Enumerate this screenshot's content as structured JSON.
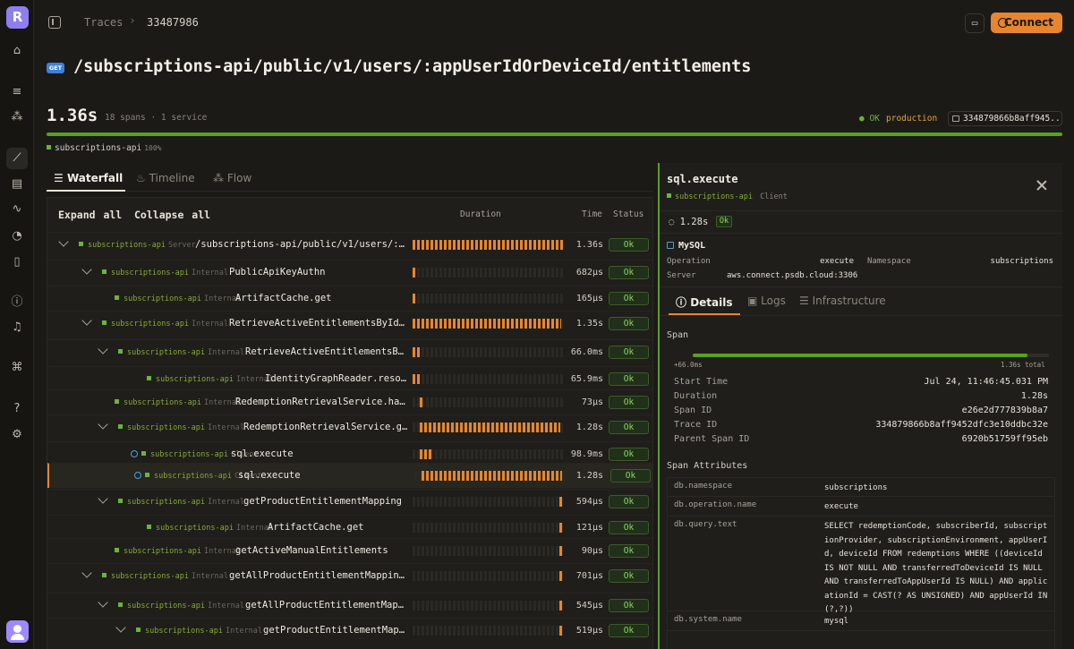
{
  "breadcrumb": {
    "parent": "Traces",
    "current": "33487986"
  },
  "header": {
    "connect_label": "Connect"
  },
  "trace": {
    "method": "GET",
    "path": "/subscriptions-api/public/v1/users/:appUserIdOrDeviceId/entitlements",
    "duration": "1.36s",
    "summary": "18 spans · 1 service",
    "status": "OK",
    "environment": "production",
    "trace_id_short": "334879866b8aff945...",
    "service_bar": {
      "name": "subscriptions-api",
      "percent": "100%"
    }
  },
  "tabs": [
    {
      "label": "Waterfall",
      "icon": "list-icon"
    },
    {
      "label": "Timeline",
      "icon": "flame-icon"
    },
    {
      "label": "Flow",
      "icon": "flow-icon"
    }
  ],
  "table": {
    "expand_label": "Expand all",
    "collapse_label": "Collapse all",
    "col_duration": "Duration",
    "col_time": "Time",
    "col_status": "Status",
    "rows": [
      {
        "service": "subscriptions-api",
        "kind": "Server",
        "name": "/subscriptions-api/public/v1/users/:app…",
        "time": "1.36s",
        "status": "Ok",
        "bar_start": 0.0,
        "bar_width": 1.0,
        "expanded": true
      },
      {
        "service": "subscriptions-api",
        "kind": "Internal",
        "name": "PublicApiKeyAuthn",
        "time": "682µs",
        "status": "Ok",
        "bar_start": 0.0,
        "bar_width": 0.02,
        "expanded": true
      },
      {
        "service": "subscriptions-api",
        "kind": "Internal",
        "name": "ArtifactCache.get",
        "time": "165µs",
        "status": "Ok",
        "bar_start": 0.0,
        "bar_width": 0.02
      },
      {
        "service": "subscriptions-api",
        "kind": "Internal",
        "name": "RetrieveActiveEntitlementsByIdent…",
        "time": "1.35s",
        "status": "Ok",
        "bar_start": 0.0,
        "bar_width": 0.99,
        "expanded": true
      },
      {
        "service": "subscriptions-api",
        "kind": "Internal",
        "name": "RetrieveActiveEntitlementsByI…",
        "time": "66.0ms",
        "status": "Ok",
        "bar_start": 0.0,
        "bar_width": 0.05,
        "expanded": true
      },
      {
        "service": "subscriptions-api",
        "kind": "Internal",
        "name": "IdentityGraphReader.resolv…",
        "time": "65.9ms",
        "status": "Ok",
        "bar_start": 0.0,
        "bar_width": 0.05
      },
      {
        "service": "subscriptions-api",
        "kind": "Internal",
        "name": "RedemptionRetrievalService.hasA…",
        "time": "73µs",
        "status": "Ok",
        "bar_start": 0.045,
        "bar_width": 0.02
      },
      {
        "service": "subscriptions-api",
        "kind": "Internal",
        "name": "RedemptionRetrievalService.get…",
        "time": "1.28s",
        "status": "Ok",
        "bar_start": 0.045,
        "bar_width": 0.94,
        "expanded": true
      },
      {
        "service": "subscriptions-api",
        "kind": "Client",
        "name": "sql.execute",
        "time": "98.9ms",
        "status": "Ok",
        "bar_start": 0.045,
        "bar_width": 0.08,
        "db": true
      },
      {
        "service": "subscriptions-api",
        "kind": "Client",
        "name": "sql.execute",
        "time": "1.28s",
        "status": "Ok",
        "bar_start": 0.045,
        "bar_width": 0.94,
        "db": true,
        "selected": true
      },
      {
        "service": "subscriptions-api",
        "kind": "Internal",
        "name": "getProductEntitlementMapping",
        "time": "594µs",
        "status": "Ok",
        "bar_start": 0.975,
        "bar_width": 0.02,
        "expanded": true
      },
      {
        "service": "subscriptions-api",
        "kind": "Internal",
        "name": "ArtifactCache.get",
        "time": "121µs",
        "status": "Ok",
        "bar_start": 0.975,
        "bar_width": 0.02
      },
      {
        "service": "subscriptions-api",
        "kind": "Internal",
        "name": "getActiveManualEntitlements",
        "time": "90µs",
        "status": "Ok",
        "bar_start": 0.975,
        "bar_width": 0.02
      },
      {
        "service": "subscriptions-api",
        "kind": "Internal",
        "name": "getAllProductEntitlementMappingBy…",
        "time": "701µs",
        "status": "Ok",
        "bar_start": 0.975,
        "bar_width": 0.02,
        "expanded": true
      },
      {
        "service": "subscriptions-api",
        "kind": "Internal",
        "name": "getAllProductEntitlementMappi…",
        "time": "545µs",
        "status": "Ok",
        "bar_start": 0.975,
        "bar_width": 0.02,
        "expanded": true
      },
      {
        "service": "subscriptions-api",
        "kind": "Internal",
        "name": "getProductEntitlementMappi…",
        "time": "519µs",
        "status": "Ok",
        "bar_start": 0.975,
        "bar_width": 0.02,
        "expanded": true
      }
    ]
  },
  "detail": {
    "title": "sql.execute",
    "service": "subscriptions-api",
    "kind": "Client",
    "duration": "1.28s",
    "status": "Ok",
    "db_system": "MySQL",
    "operation_label": "Operation",
    "operation_value": "execute",
    "namespace_label": "Namespace",
    "namespace_value": "subscriptions",
    "server_label": "Server",
    "server_value": "aws.connect.psdb.cloud:3306",
    "tabs": [
      {
        "label": "Details",
        "icon": "info-icon"
      },
      {
        "label": "Logs",
        "icon": "terminal-icon"
      },
      {
        "label": "Infrastructure",
        "icon": "server-icon"
      }
    ],
    "span_section": "Span",
    "span_offset": "+66.0ms",
    "span_total": "1.36s total",
    "span_fill": 0.94,
    "fields": [
      {
        "label": "Start Time",
        "value": "Jul 24, 11:46:45.031 PM"
      },
      {
        "label": "Duration",
        "value": "1.28s"
      },
      {
        "label": "Span ID",
        "value": "e26e2d777839b8a7"
      },
      {
        "label": "Trace ID",
        "value": "334879866b8aff9452dfc3e10ddbc32e"
      },
      {
        "label": "Parent Span ID",
        "value": "6920b51759ff95eb"
      }
    ],
    "attributes_section": "Span Attributes",
    "attributes": [
      {
        "key": "db.namespace",
        "value": "subscriptions"
      },
      {
        "key": "db.operation.name",
        "value": "execute"
      },
      {
        "key": "db.query.text",
        "value": "SELECT redemptionCode, subscriberId, subscriptionProvider, subscriptionEnvironment, appUserId, deviceId FROM redemptions WHERE ((deviceId IS NOT NULL AND transferredToDeviceId IS NULL AND transferredToAppUserId IS NULL) AND applicationId = CAST(? AS UNSIGNED) AND appUserId IN (?,?))"
      },
      {
        "key": "db.system.name",
        "value": "mysql"
      }
    ]
  }
}
